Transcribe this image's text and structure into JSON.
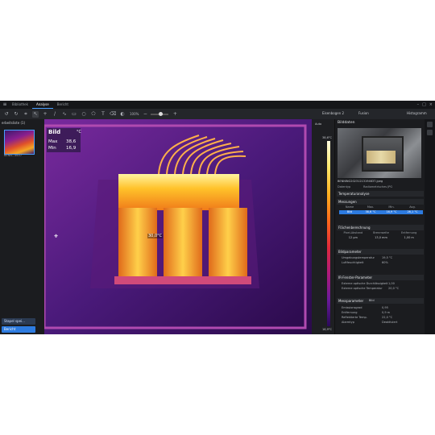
{
  "titlebar": {
    "tabs": [
      {
        "label": "Bibliothek"
      },
      {
        "label": "Analyse"
      },
      {
        "label": "Bericht"
      }
    ],
    "window_controls": [
      "minimize-icon",
      "maximize-icon",
      "close-icon"
    ]
  },
  "toolbar": {
    "zoom": "100%",
    "dropdown_palette": "Eisenbogen 2",
    "dropdown_mode": "Fusion",
    "dropdown_view": "Histogramm"
  },
  "sidebar": {
    "title": "erbeitsliste (1)",
    "thumb_label": "BENN...4637",
    "btn_stack": "Stapel spei...",
    "btn_report": "Bericht"
  },
  "image": {
    "title": "Bild",
    "unit": "°C",
    "max_label": "Max",
    "max_value": "38,6",
    "min_label": "Min",
    "min_value": "16,9",
    "spot": "30,0°C"
  },
  "scale": {
    "mode": "Auto",
    "top": "38,6°C",
    "bottom": "16,9°C"
  },
  "panel": {
    "title": "Bilddaten",
    "filename": "BENNING20231213194637.jpeg",
    "meta_left": "Datentyp",
    "meta_right": "Radiometrisches JPG",
    "section_analysis": "Temperaturanalyse",
    "section_measure": "Messungen",
    "table_headers": [
      "Name",
      "Max.",
      "Min.",
      "Avg."
    ],
    "table_rows": [
      [
        "Bild",
        "38,6 °C",
        "16,9 °C",
        "26,1 °C"
      ]
    ],
    "section_area": "Flächenberechnung",
    "area_headers": [
      "Pixel-Abstand",
      "Brennweite",
      "Entfernung"
    ],
    "area_values": [
      "12 µm",
      "13,0 mm",
      "1,00 m"
    ],
    "section_params": "Bildparameter",
    "params": [
      {
        "k": "Umgebungstemperatur",
        "v": "19,5 °C"
      },
      {
        "k": "Luftfeuchtigkeit",
        "v": "60%"
      }
    ],
    "section_ir": "IR-Fenster-Parameter",
    "ir": [
      {
        "k": "Externe optische Durchlässigkeit",
        "v": "1,00"
      },
      {
        "k": "Externe optische Temperatur",
        "v": "20,0 °C"
      }
    ],
    "section_mess": "Messparameter",
    "mess_scope": "Bild",
    "mess": [
      {
        "k": "Emissionsgrad",
        "v": "0,95"
      },
      {
        "k": "Entfernung",
        "v": "0,9 m"
      },
      {
        "k": "Reflektierte Temp.",
        "v": "22,0 °C"
      },
      {
        "k": "Alarmtyp",
        "v": "Deaktiviert"
      }
    ]
  },
  "colors": {
    "accent": "#2d7be0",
    "bg": "#1e1f22"
  }
}
